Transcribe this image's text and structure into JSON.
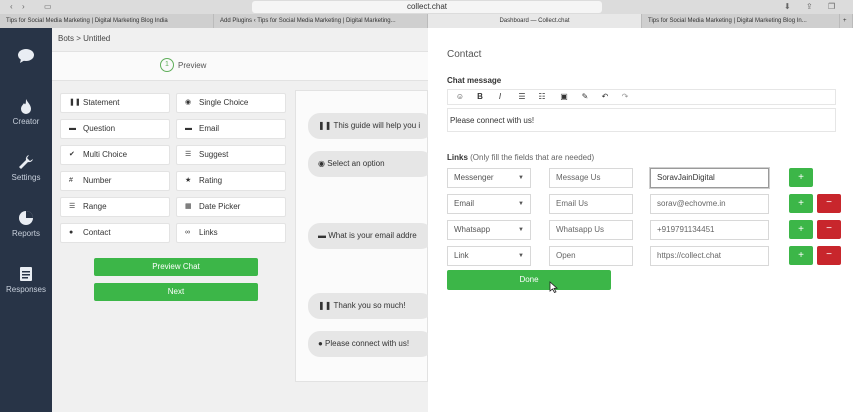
{
  "browser": {
    "url": "collect.chat",
    "tabs": [
      {
        "label": "Tips for Social Media Marketing | Digital Marketing Blog India"
      },
      {
        "label": "Add Plugins ‹ Tips for Social Media Marketing | Digital Marketing..."
      },
      {
        "label": "Dashboard — Collect.chat"
      },
      {
        "label": "Tips for Social Media Marketing | Digital Marketing Blog In..."
      }
    ],
    "new_tab": "+"
  },
  "sidebar": {
    "items": [
      {
        "label": "",
        "icon": "chat-bubble-icon"
      },
      {
        "label": "Creator",
        "icon": "flame-icon"
      },
      {
        "label": "Settings",
        "icon": "wrench-icon"
      },
      {
        "label": "Reports",
        "icon": "pie-chart-icon"
      },
      {
        "label": "Responses",
        "icon": "document-icon"
      }
    ]
  },
  "main": {
    "breadcrumb": "Bots > Untitled",
    "step": {
      "number": "1",
      "label": "Preview"
    },
    "components": [
      {
        "label": "Statement",
        "icon": "❚❚"
      },
      {
        "label": "Single Choice",
        "icon": "◉"
      },
      {
        "label": "Question",
        "icon": "▬"
      },
      {
        "label": "Email",
        "icon": "▬"
      },
      {
        "label": "Multi Choice",
        "icon": "✔"
      },
      {
        "label": "Suggest",
        "icon": "☰"
      },
      {
        "label": "Number",
        "icon": "#"
      },
      {
        "label": "Rating",
        "icon": "★"
      },
      {
        "label": "Range",
        "icon": "☰"
      },
      {
        "label": "Date Picker",
        "icon": "▦"
      },
      {
        "label": "Contact",
        "icon": "●"
      },
      {
        "label": "Links",
        "icon": "∞"
      }
    ],
    "preview_chat_label": "Preview Chat",
    "next_label": "Next",
    "preview_bubbles": [
      {
        "text": "❚❚ This guide will help you i"
      },
      {
        "text": "◉ Select an option"
      },
      {
        "text": "▬ What is your email addre"
      },
      {
        "text": "❚❚ Thank you so much!"
      },
      {
        "text": "● Please connect with us!"
      }
    ]
  },
  "panel": {
    "title": "Contact",
    "chat_message_label": "Chat message",
    "toolbar": [
      "☺",
      "B",
      "I",
      "☰",
      "☷",
      "▣",
      "✎",
      "↶",
      "↷"
    ],
    "message": "Please connect with us!",
    "links_label": "Links",
    "links_note": "(Only fill the fields that are needed)",
    "link_rows": [
      {
        "type": "Messenger",
        "label": "Message Us",
        "value": "SoravJainDigital",
        "has_minus": false
      },
      {
        "type": "Email",
        "label": "Email Us",
        "value": "sorav@echovme.in",
        "has_minus": true
      },
      {
        "type": "Whatsapp",
        "label": "Whatsapp Us",
        "value": "+919791134451",
        "has_minus": true
      },
      {
        "type": "Link",
        "label": "Open",
        "value": "https://collect.chat",
        "has_minus": true
      }
    ],
    "plus_label": "+",
    "minus_label": "−",
    "done_label": "Done"
  },
  "colors": {
    "sidebar": "#283447",
    "green": "#3cb648",
    "red": "#c8262c"
  }
}
